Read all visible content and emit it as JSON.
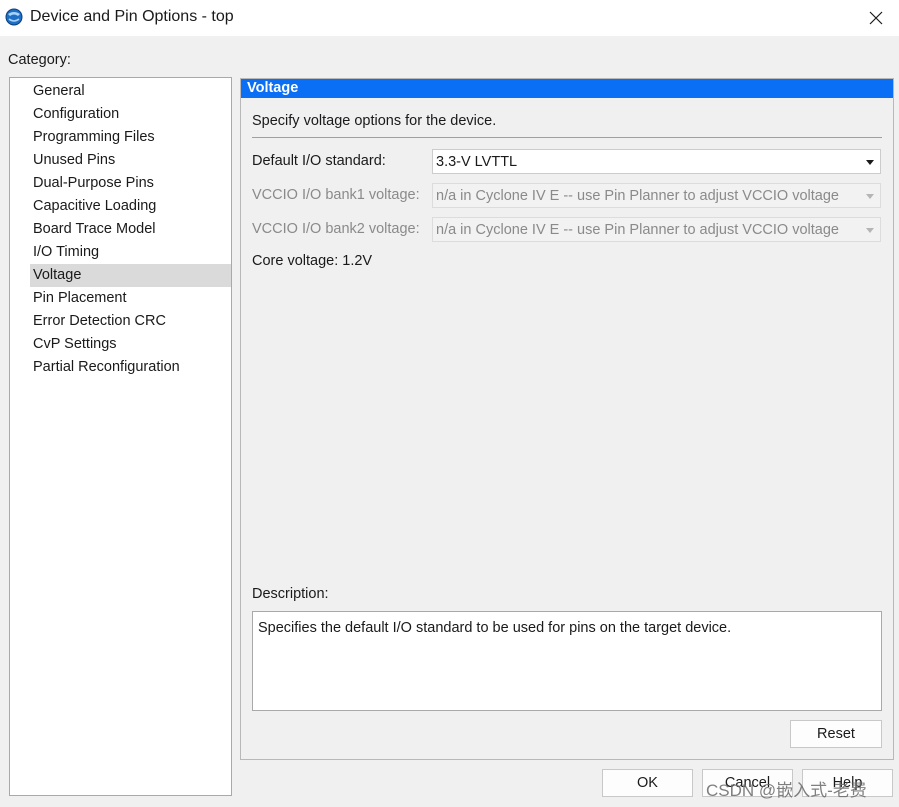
{
  "window": {
    "title": "Device and Pin Options - top"
  },
  "category": {
    "label": "Category:",
    "items": [
      {
        "label": "General"
      },
      {
        "label": "Configuration"
      },
      {
        "label": "Programming Files"
      },
      {
        "label": "Unused Pins"
      },
      {
        "label": "Dual-Purpose Pins"
      },
      {
        "label": "Capacitive Loading"
      },
      {
        "label": "Board Trace Model"
      },
      {
        "label": "I/O Timing"
      },
      {
        "label": "Voltage",
        "selected": true
      },
      {
        "label": "Pin Placement"
      },
      {
        "label": "Error Detection CRC"
      },
      {
        "label": "CvP Settings"
      },
      {
        "label": "Partial Reconfiguration"
      }
    ]
  },
  "panel": {
    "header": "Voltage",
    "intro": "Specify voltage options for the device.",
    "default_io": {
      "label": "Default I/O standard:",
      "value": "3.3-V LVTTL"
    },
    "bank1": {
      "label": "VCCIO I/O bank1 voltage:",
      "value": "n/a in Cyclone IV E -- use Pin Planner to adjust VCCIO voltage"
    },
    "bank2": {
      "label": "VCCIO I/O bank2 voltage:",
      "value": "n/a in Cyclone IV E -- use Pin Planner to adjust VCCIO voltage"
    },
    "core_voltage": "Core voltage: 1.2V",
    "description_label": "Description:",
    "description_text": "Specifies the default I/O standard to be used for pins on the target device.",
    "reset_label": "Reset"
  },
  "footer": {
    "ok_label": "OK",
    "cancel_label": "Cancel",
    "help_label": "Help"
  },
  "watermark": "CSDN @嵌入式-老费",
  "colors": {
    "header_bg": "#0a6ff4",
    "selected_bg": "#dadada",
    "window_bg": "#f0f0f0"
  }
}
